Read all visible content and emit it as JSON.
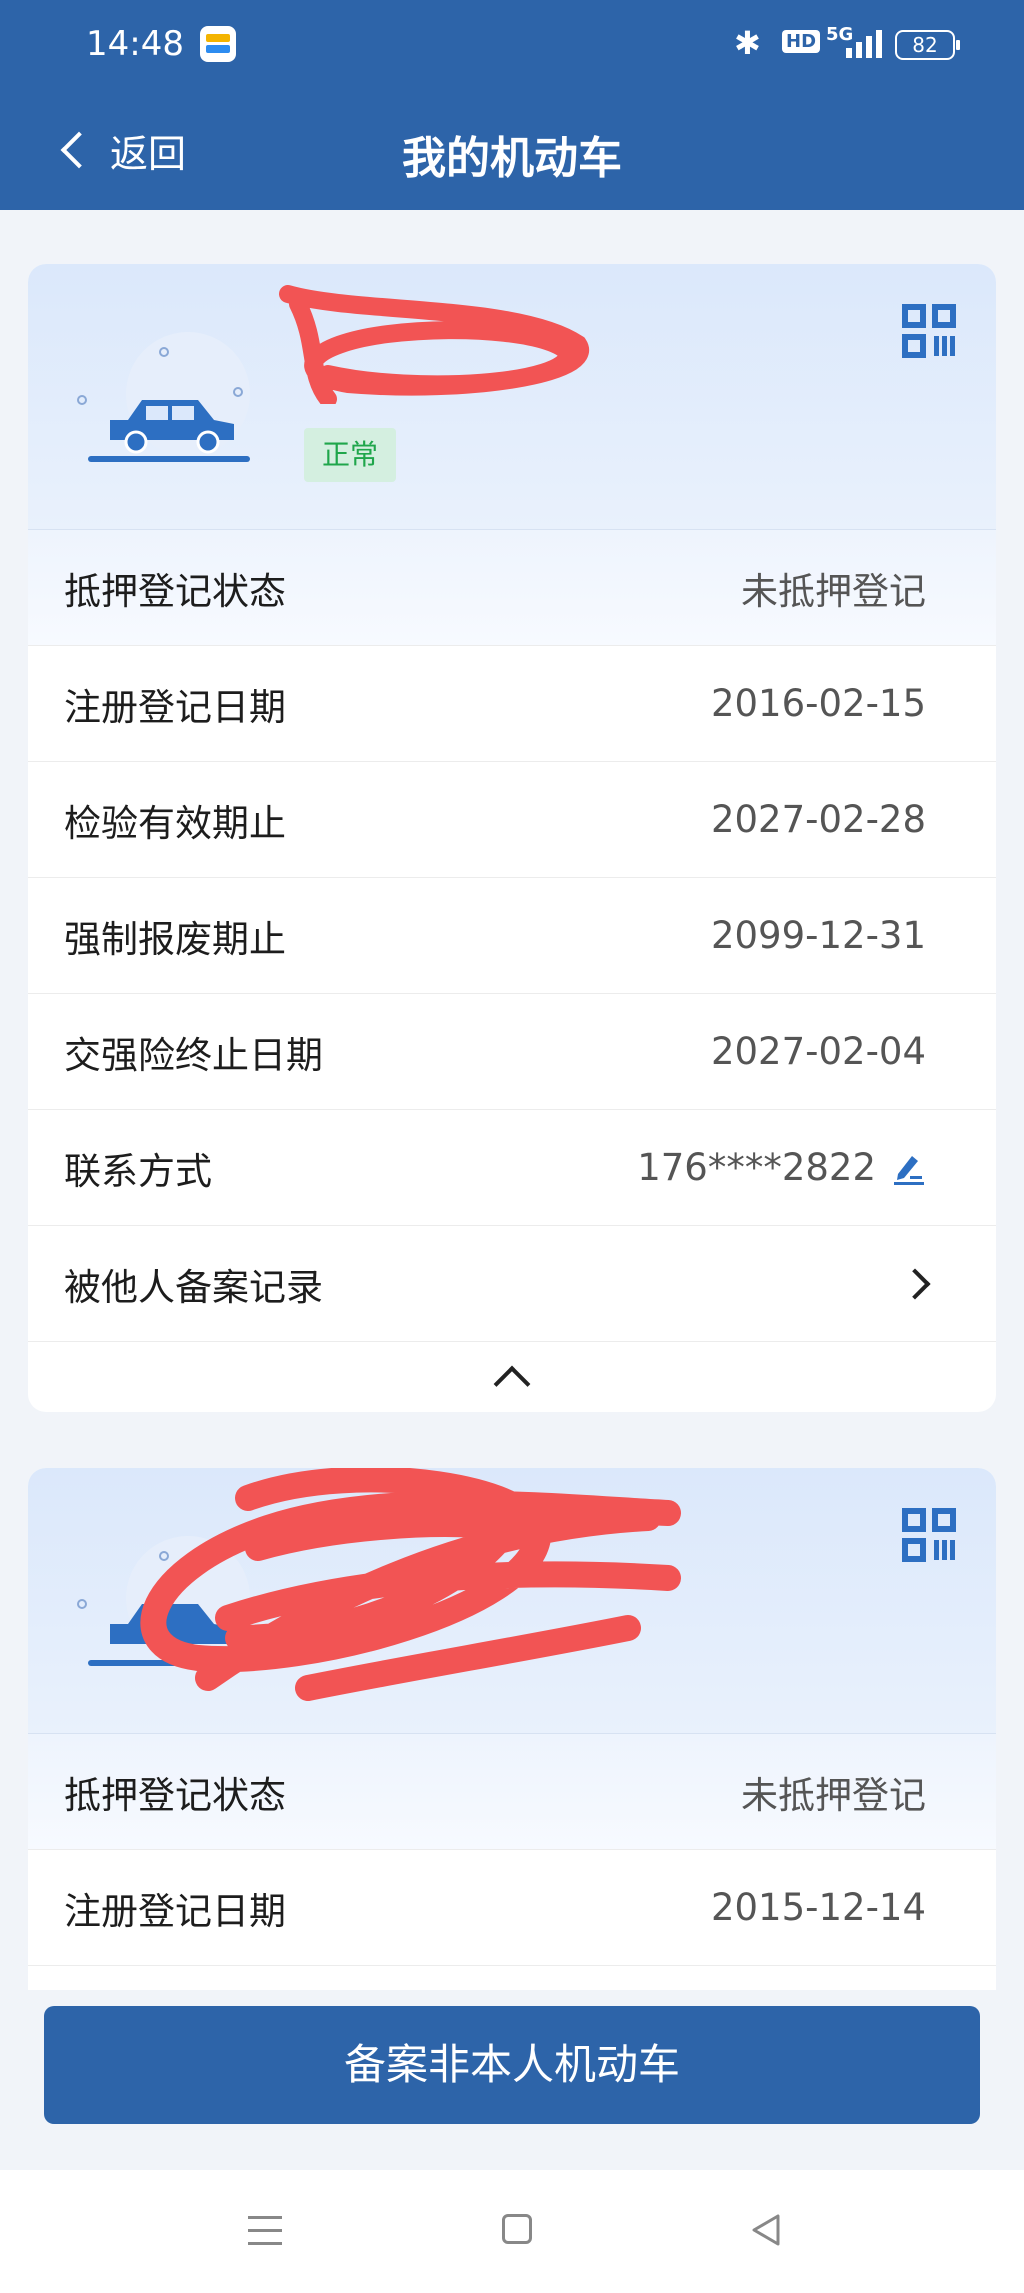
{
  "status_bar": {
    "time": "14:48",
    "battery": "82",
    "network": "5G",
    "hd": "HD"
  },
  "header": {
    "back_label": "返回",
    "title": "我的机动车"
  },
  "vehicles": [
    {
      "status": "正常",
      "rows": [
        {
          "label": "抵押登记状态",
          "value": "未抵押登记"
        },
        {
          "label": "注册登记日期",
          "value": "2016-02-15"
        },
        {
          "label": "检验有效期止",
          "value": "2027-02-28"
        },
        {
          "label": "强制报废期止",
          "value": "2099-12-31"
        },
        {
          "label": "交强险终止日期",
          "value": "2027-02-04"
        },
        {
          "label": "联系方式",
          "value": "176****2822"
        },
        {
          "label": "被他人备案记录",
          "value": ""
        }
      ]
    },
    {
      "rows": [
        {
          "label": "抵押登记状态",
          "value": "未抵押登记"
        },
        {
          "label": "注册登记日期",
          "value": "2015-12-14"
        }
      ]
    }
  ],
  "action_button": "备案非本人机动车",
  "colors": {
    "brand": "#2d64a9",
    "badge_bg": "#d4efe0",
    "badge_text": "#1fa64b",
    "redaction": "#f25454"
  }
}
